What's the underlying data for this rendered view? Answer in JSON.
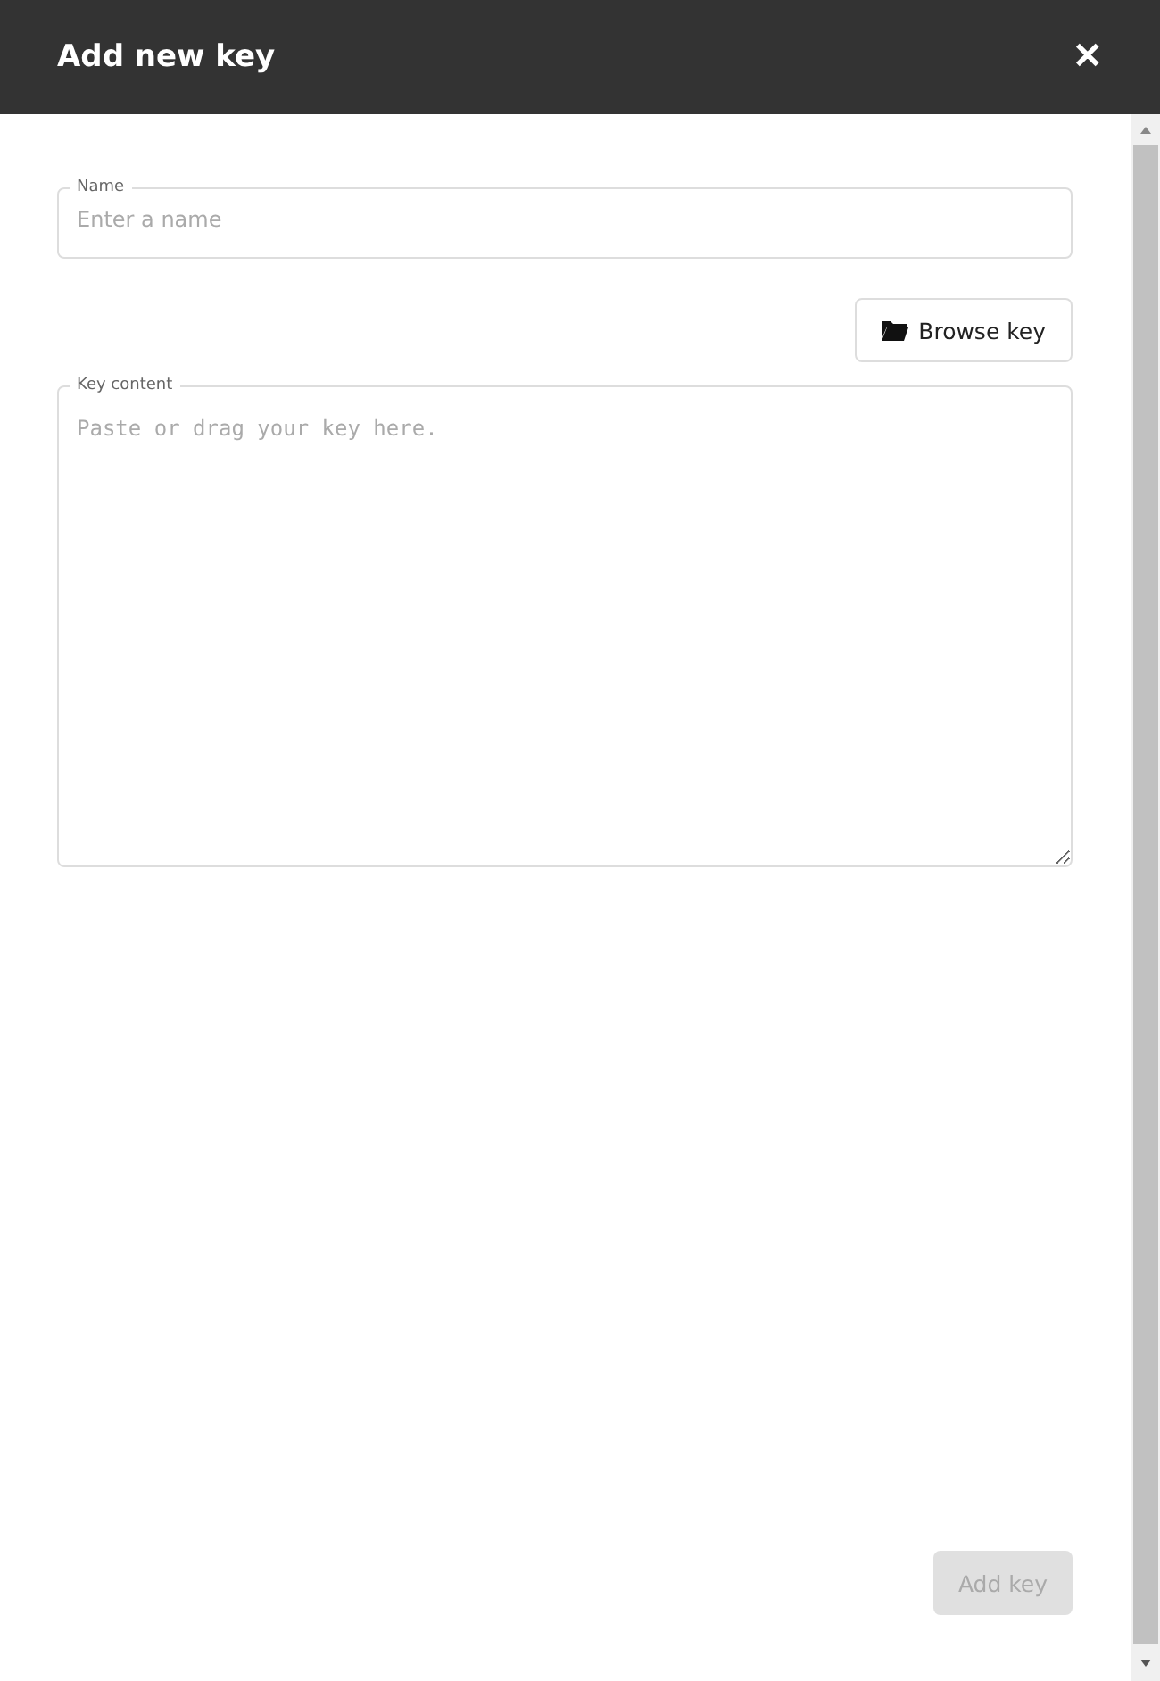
{
  "dialog": {
    "title": "Add new key",
    "close": "✕"
  },
  "name_field": {
    "label": "Name",
    "placeholder": "Enter a name"
  },
  "browse_button": {
    "label": "Browse key"
  },
  "key_field": {
    "label": "Key content",
    "placeholder": "Paste or drag your key here."
  },
  "submit_button": {
    "label": "Add key",
    "disabled": true
  }
}
